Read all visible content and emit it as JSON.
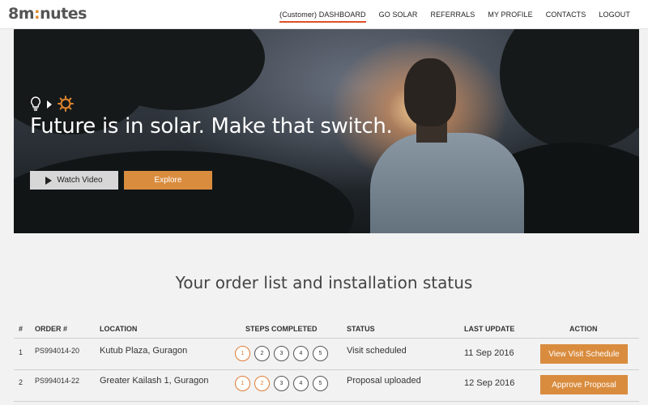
{
  "header": {
    "logo_main": "8m",
    "logo_colon": ":",
    "logo_rest": "nutes",
    "nav": [
      {
        "label": "(Customer) DASHBOARD",
        "active": true
      },
      {
        "label": "GO SOLAR"
      },
      {
        "label": "REFERRALS"
      },
      {
        "label": "MY PROFILE"
      },
      {
        "label": "CONTACTS"
      },
      {
        "label": "LOGOUT"
      }
    ]
  },
  "hero": {
    "icons": [
      "lightbulb-icon",
      "arrow-right-icon",
      "sun-icon"
    ],
    "title": "Future is in solar. Make that switch.",
    "watch_label": "Watch Video",
    "explore_label": "Explore"
  },
  "orders": {
    "title": "Your order list and installation status",
    "columns": [
      "#",
      "ORDER #",
      "LOCATION",
      "STEPS COMPLETED",
      "STATUS",
      "LAST UPDATE",
      "ACTION"
    ],
    "rows": [
      {
        "num": "1",
        "order": "PS994014-20",
        "location": "Kutub Plaza, Guragon",
        "steps": [
          "1",
          "2",
          "3",
          "4",
          "5"
        ],
        "completed": 1,
        "status": "Visit scheduled",
        "last_update": "11 Sep 2016",
        "action": "View Visit Schedule"
      },
      {
        "num": "2",
        "order": "PS994014-22",
        "location": "Greater Kailash 1, Guragon",
        "steps": [
          "1",
          "2",
          "3",
          "4",
          "5"
        ],
        "completed": 2,
        "status": "Proposal uploaded",
        "last_update": "12 Sep 2016",
        "action": "Approve Proposal"
      }
    ]
  },
  "colors": {
    "accent": "#d98c3e",
    "nav_underline": "#e0502a"
  }
}
